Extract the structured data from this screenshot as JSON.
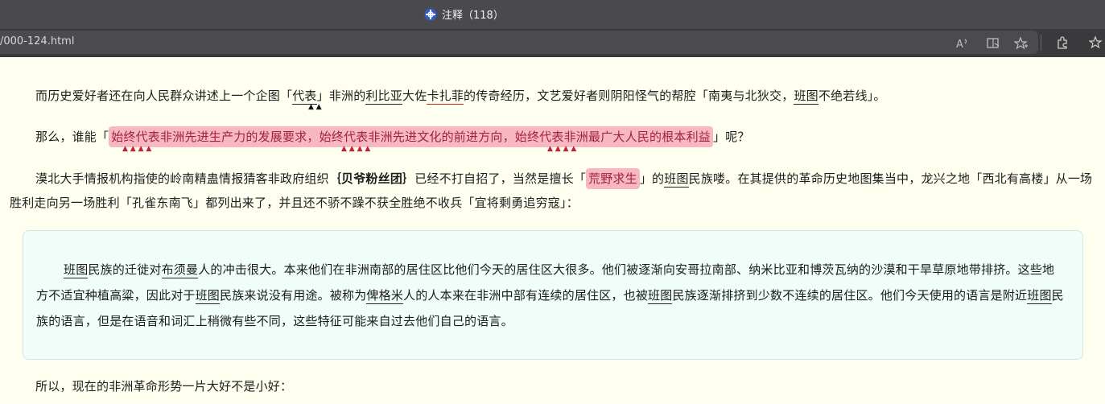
{
  "browser": {
    "tab_title": "注释（118）",
    "url": "/000-124.html",
    "colors": {
      "title_bg": "#4a4a4e",
      "address_bg": "#3a3a3c",
      "page_bg": "#fffff0",
      "highlight_bg": "#f7b8c4",
      "highlight_text": "#a0243a"
    },
    "icons": [
      "site-logo-icon",
      "read-aloud-icon",
      "immersive-reader-icon",
      "add-favorite-icon",
      "extensions-icon",
      "favorites-icon"
    ]
  },
  "p1": {
    "t1": "而历史爱好者还在向人民群众讲述上一个企图「",
    "l1": "代表",
    "t2": "」非洲的",
    "l2": "利比亚",
    "t3": "大佐",
    "l3": "卡扎菲",
    "t4": "的传奇经历，文艺爱好者则阴阳怪气的帮腔「南夷与北狄交，",
    "l4": "班图",
    "t5": "不绝若线」。",
    "marks": "▲ ▲"
  },
  "p2": {
    "t1": "那么，谁能「",
    "hl": "始终代表非洲先进生产力的发展要求，始终代表非洲先进文化的前进方向，始终代表非洲最广大人民的根本利益",
    "t2": "」呢？",
    "marks1": "▲ ▲ ▲ ▲",
    "marks2": "▲ ▲ ▲ ▲",
    "marks3": "▲ ▲ ▲ ▲"
  },
  "p3": {
    "t1": "漠北大手情报机构指使的岭南精蛊情报猜客非政府组织",
    "bold": "｛贝爷粉丝团｝",
    "t2": "已经不打自招了，当然是擅长「",
    "hl": "荒野求生",
    "t3": "」的",
    "l1": "班图",
    "t4": "民族喽。在其提供的革命历史地图集当中，龙兴之地「西北有高楼」从一场胜利走向另一场胜利「孔雀东南飞」都列出来了，并且还不骄不躁不获全胜绝不收兵「宜将剩勇追穷寇」："
  },
  "note": {
    "l1": "班图",
    "t1": "民族的迁徙对",
    "l2": "布须曼",
    "t2": "人的冲击很大。本来他们在非洲南部的居住区比他们今天的居住区大很多。他们被逐渐向安哥拉南部、纳米比亚和博茨瓦纳的沙漠和干旱草原地带排挤。这些地方不适宜种植高粱，因此对于",
    "l3": "班图",
    "t3": "民族来说没有用途。被称为",
    "l4": "俾格米",
    "t4": "人的人本来在非洲中部有连续的居住区，也被",
    "l5": "班图",
    "t5": "民族逐渐排挤到少数不连续的居住区。他们今天使用的语言是附近",
    "l6": "班图",
    "t6": "民族的语言，但是在语音和词汇上稍微有些不同，这些特征可能来自过去他们自己的语言。"
  },
  "p4": {
    "t1": "所以，现在的非洲革命形势一片大好不是小好："
  }
}
